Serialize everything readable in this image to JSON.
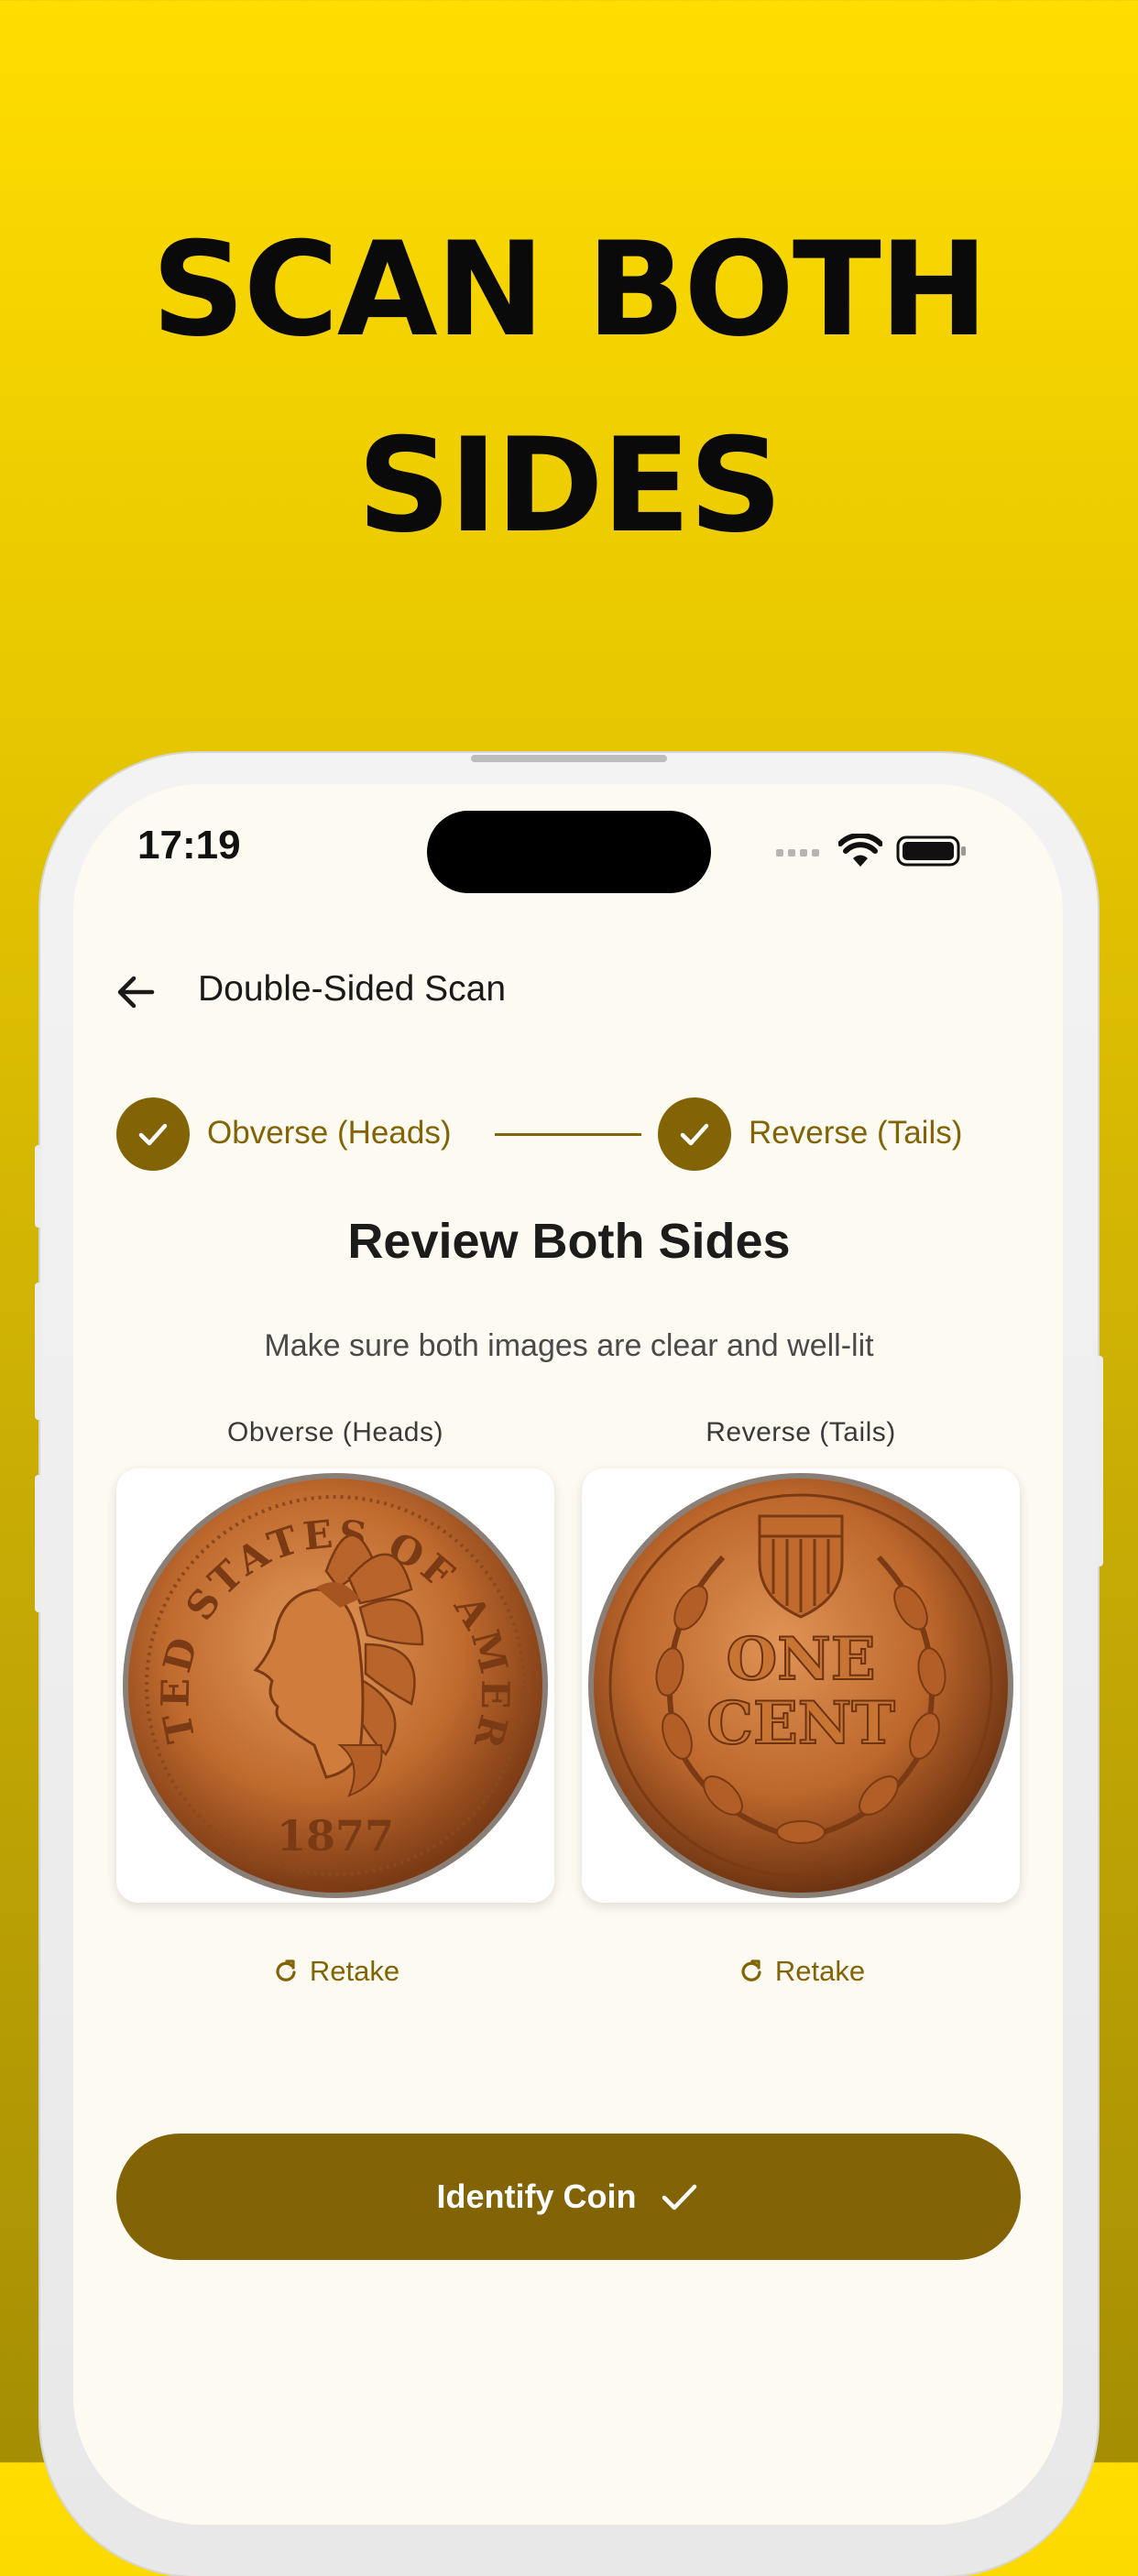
{
  "headline": {
    "line1": "SCAN BOTH",
    "line2": "SIDES"
  },
  "status_bar": {
    "time": "17:19",
    "icons": [
      "signal-icon",
      "wifi-icon",
      "battery-icon"
    ]
  },
  "app_bar": {
    "title": "Double-Sided Scan",
    "back_icon": "arrow-left-icon"
  },
  "stepper": {
    "steps": [
      {
        "label": "Obverse (Heads)",
        "completed": true
      },
      {
        "label": "Reverse (Tails)",
        "completed": true
      }
    ]
  },
  "review": {
    "title": "Review Both Sides",
    "subtitle": "Make sure both images are clear and well-lit"
  },
  "images": [
    {
      "label": "Obverse (Heads)",
      "retake_label": "Retake",
      "coin_legend": "UNITED STATES OF AMERICA",
      "coin_year": "1877"
    },
    {
      "label": "Reverse (Tails)",
      "retake_label": "Retake",
      "coin_text_1": "ONE",
      "coin_text_2": "CENT"
    }
  ],
  "action": {
    "label": "Identify Coin",
    "icon": "check-icon"
  },
  "colors": {
    "accent": "#826406",
    "background": "#FDFAF2",
    "headline_bg": "#FFDD00"
  }
}
